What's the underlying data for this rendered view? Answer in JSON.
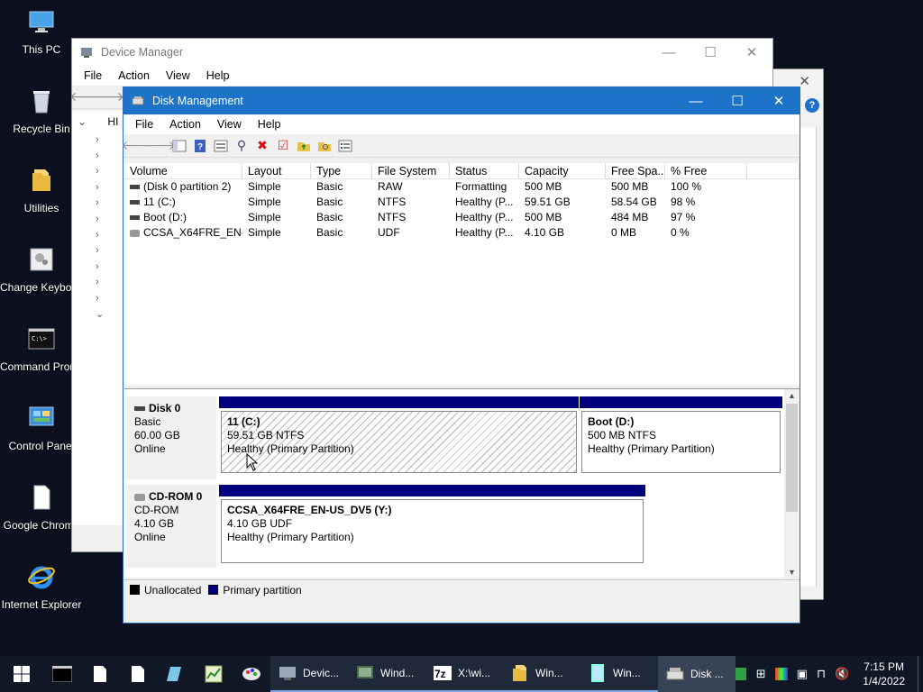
{
  "desktop": {
    "icons": [
      {
        "label": "This PC"
      },
      {
        "label": "Recycle Bin"
      },
      {
        "label": "Utilities"
      },
      {
        "label": "Change Keyboard Layout"
      },
      {
        "label": "Command Prompt"
      },
      {
        "label": "Control Panel"
      },
      {
        "label": "Google Chrome"
      },
      {
        "label": "Internet Explorer"
      }
    ]
  },
  "device_manager": {
    "title": "Device Manager",
    "menu": [
      "File",
      "Action",
      "View",
      "Help"
    ],
    "tree_first_label": "HI"
  },
  "disk_management": {
    "title": "Disk Management",
    "menu": [
      "File",
      "Action",
      "View",
      "Help"
    ],
    "columns": [
      "Volume",
      "Layout",
      "Type",
      "File System",
      "Status",
      "Capacity",
      "Free Spa...",
      "% Free"
    ],
    "volumes": [
      {
        "volume": "(Disk 0 partition 2)",
        "layout": "Simple",
        "type": "Basic",
        "fs": "RAW",
        "status": "Formatting",
        "capacity": "500 MB",
        "free": "500 MB",
        "pct": "100 %"
      },
      {
        "volume": "11 (C:)",
        "layout": "Simple",
        "type": "Basic",
        "fs": "NTFS",
        "status": "Healthy (P...",
        "capacity": "59.51 GB",
        "free": "58.54 GB",
        "pct": "98 %"
      },
      {
        "volume": "Boot (D:)",
        "layout": "Simple",
        "type": "Basic",
        "fs": "NTFS",
        "status": "Healthy (P...",
        "capacity": "500 MB",
        "free": "484 MB",
        "pct": "97 %"
      },
      {
        "volume": "CCSA_X64FRE_EN-...",
        "layout": "Simple",
        "type": "Basic",
        "fs": "UDF",
        "status": "Healthy (P...",
        "capacity": "4.10 GB",
        "free": "0 MB",
        "pct": "0 %"
      }
    ],
    "disks": [
      {
        "name": "Disk 0",
        "kind": "Basic",
        "size": "60.00 GB",
        "state": "Online",
        "partitions": [
          {
            "name": "11  (C:)",
            "size_fs": "59.51 GB NTFS",
            "status": "Healthy (Primary Partition)"
          },
          {
            "name": "Boot  (D:)",
            "size_fs": "500 MB NTFS",
            "status": "Healthy (Primary Partition)"
          }
        ]
      },
      {
        "name": "CD-ROM 0",
        "kind": "CD-ROM",
        "size": "4.10 GB",
        "state": "Online",
        "partitions": [
          {
            "name": "CCSA_X64FRE_EN-US_DV5  (Y:)",
            "size_fs": "4.10 GB UDF",
            "status": "Healthy (Primary Partition)"
          }
        ]
      }
    ],
    "legend": {
      "unallocated": "Unallocated",
      "primary": "Primary partition"
    },
    "colors": {
      "primary": "#00007f",
      "unallocated": "#000000"
    }
  },
  "taskbar": {
    "apps": [
      {
        "label": "Devic...",
        "icon": "device-manager-icon"
      },
      {
        "label": "Wind...",
        "icon": "windows-setup-icon"
      },
      {
        "label": "X:\\wi...",
        "icon": "7zip-icon"
      },
      {
        "label": "Win...",
        "icon": "folder-icon"
      },
      {
        "label": "Win...",
        "icon": "notepad-icon"
      },
      {
        "label": "Disk ...",
        "icon": "disk-management-icon"
      }
    ],
    "clock_time": "7:15 PM",
    "clock_date": "1/4/2022"
  }
}
